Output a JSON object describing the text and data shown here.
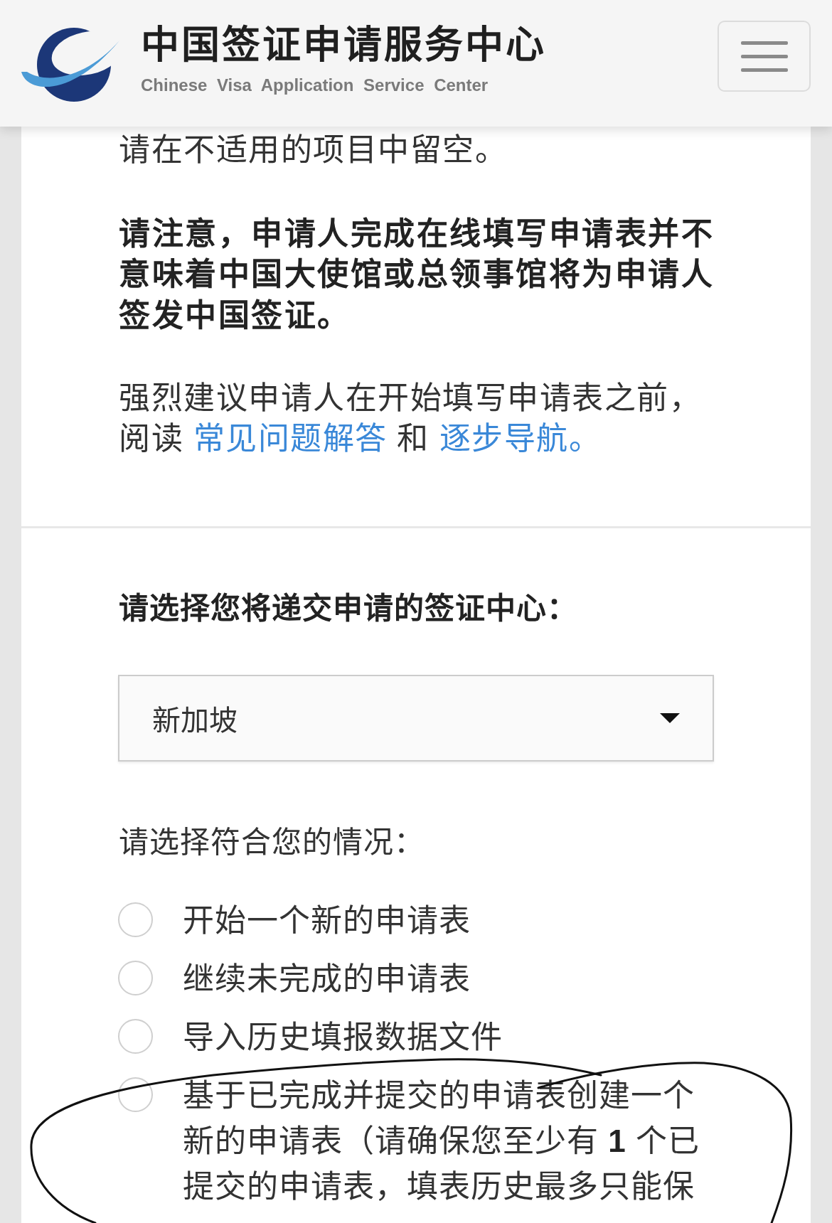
{
  "header": {
    "title": "中国签证申请服务中心",
    "subtitle": "Chinese Visa Application Service Center"
  },
  "intro": [
    {
      "kind": "plain",
      "text": "请在不适用的项目中留空。"
    },
    {
      "kind": "notice",
      "text": "请注意，申请人完成在线填写申请表并不意味着中国大使馆或总领事馆将为申请人签发中国签证。"
    },
    {
      "kind": "links",
      "parts": [
        {
          "kind": "text",
          "text": "强烈建议申请人在开始填写申请表之前，阅读 "
        },
        {
          "kind": "link",
          "text": "常见问题解答"
        },
        {
          "kind": "text",
          "text": " 和 "
        },
        {
          "kind": "link",
          "text": "逐步导航。"
        }
      ]
    }
  ],
  "center_select": {
    "label": "请选择您将递交申请的签证中心：",
    "value": "新加坡"
  },
  "situation": {
    "prompt": "请选择符合您的情况：",
    "options": [
      {
        "label": "开始一个新的申请表",
        "selected": false
      },
      {
        "label": "继续未完成的申请表",
        "selected": false
      },
      {
        "label": "导入历史填报数据文件",
        "selected": false
      },
      {
        "label": "基于已完成并提交的申请表创建一个新的申请表（请确保您至少有 **1** 个已提交的申请表，填表历史最多只能保",
        "selected": false
      }
    ]
  }
}
